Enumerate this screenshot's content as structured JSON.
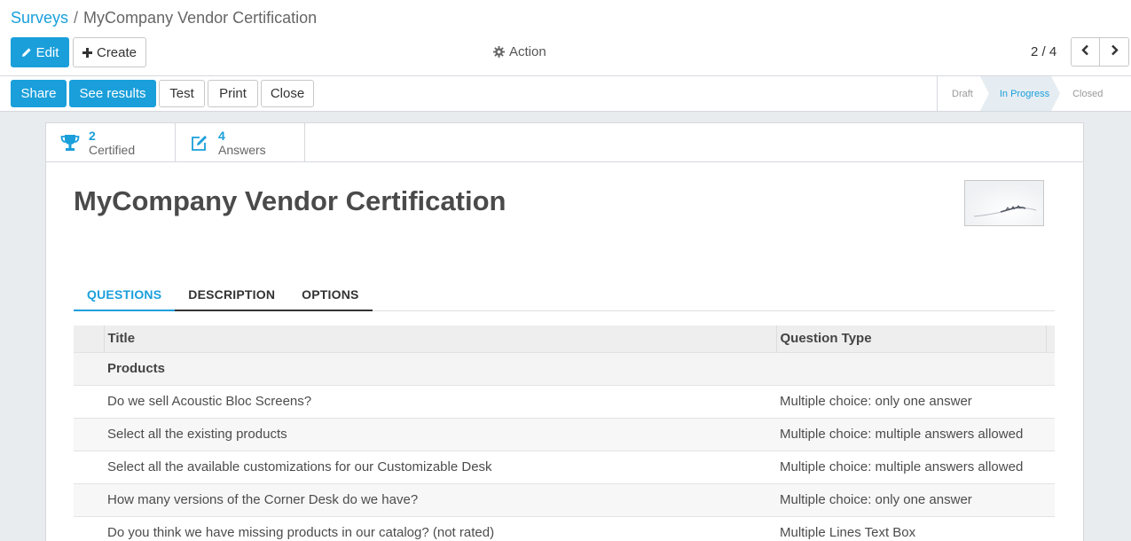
{
  "breadcrumb": {
    "parent": "Surveys",
    "separator": "/",
    "current": "MyCompany Vendor Certification"
  },
  "toolbar": {
    "edit_label": "Edit",
    "create_label": "Create",
    "action_label": "Action",
    "pager_value": "2 / 4"
  },
  "statusbar": {
    "share_label": "Share",
    "see_results_label": "See results",
    "test_label": "Test",
    "print_label": "Print",
    "close_label": "Close",
    "steps": [
      "Draft",
      "In Progress",
      "Closed"
    ],
    "active_step": "In Progress"
  },
  "stats": {
    "certified_value": "2",
    "certified_label": "Certified",
    "answers_value": "4",
    "answers_label": "Answers"
  },
  "record": {
    "title": "MyCompany Vendor Certification"
  },
  "tabs": [
    "QUESTIONS",
    "DESCRIPTION",
    "OPTIONS"
  ],
  "table": {
    "columns": [
      "Title",
      "Question Type"
    ],
    "section": "Products",
    "rows": [
      {
        "title": "Do we sell Acoustic Bloc Screens?",
        "type": "Multiple choice: only one answer"
      },
      {
        "title": "Select all the existing products",
        "type": "Multiple choice: multiple answers allowed"
      },
      {
        "title": "Select all the available customizations for our Customizable Desk",
        "type": "Multiple choice: multiple answers allowed"
      },
      {
        "title": "How many versions of the Corner Desk do we have?",
        "type": "Multiple choice: only one answer"
      },
      {
        "title": "Do you think we have missing products in our catalog? (not rated)",
        "type": "Multiple Lines Text Box"
      }
    ]
  },
  "colors": {
    "accent": "#1a9fdb",
    "background": "#e9ecef",
    "status_active_bg": "#e6edf2"
  },
  "icons": {
    "edit": "pencil-icon",
    "create": "plus-icon",
    "action": "gear-icon",
    "prev": "chevron-left-icon",
    "next": "chevron-right-icon",
    "certified": "trophy-icon",
    "answers": "edit-square-icon"
  }
}
